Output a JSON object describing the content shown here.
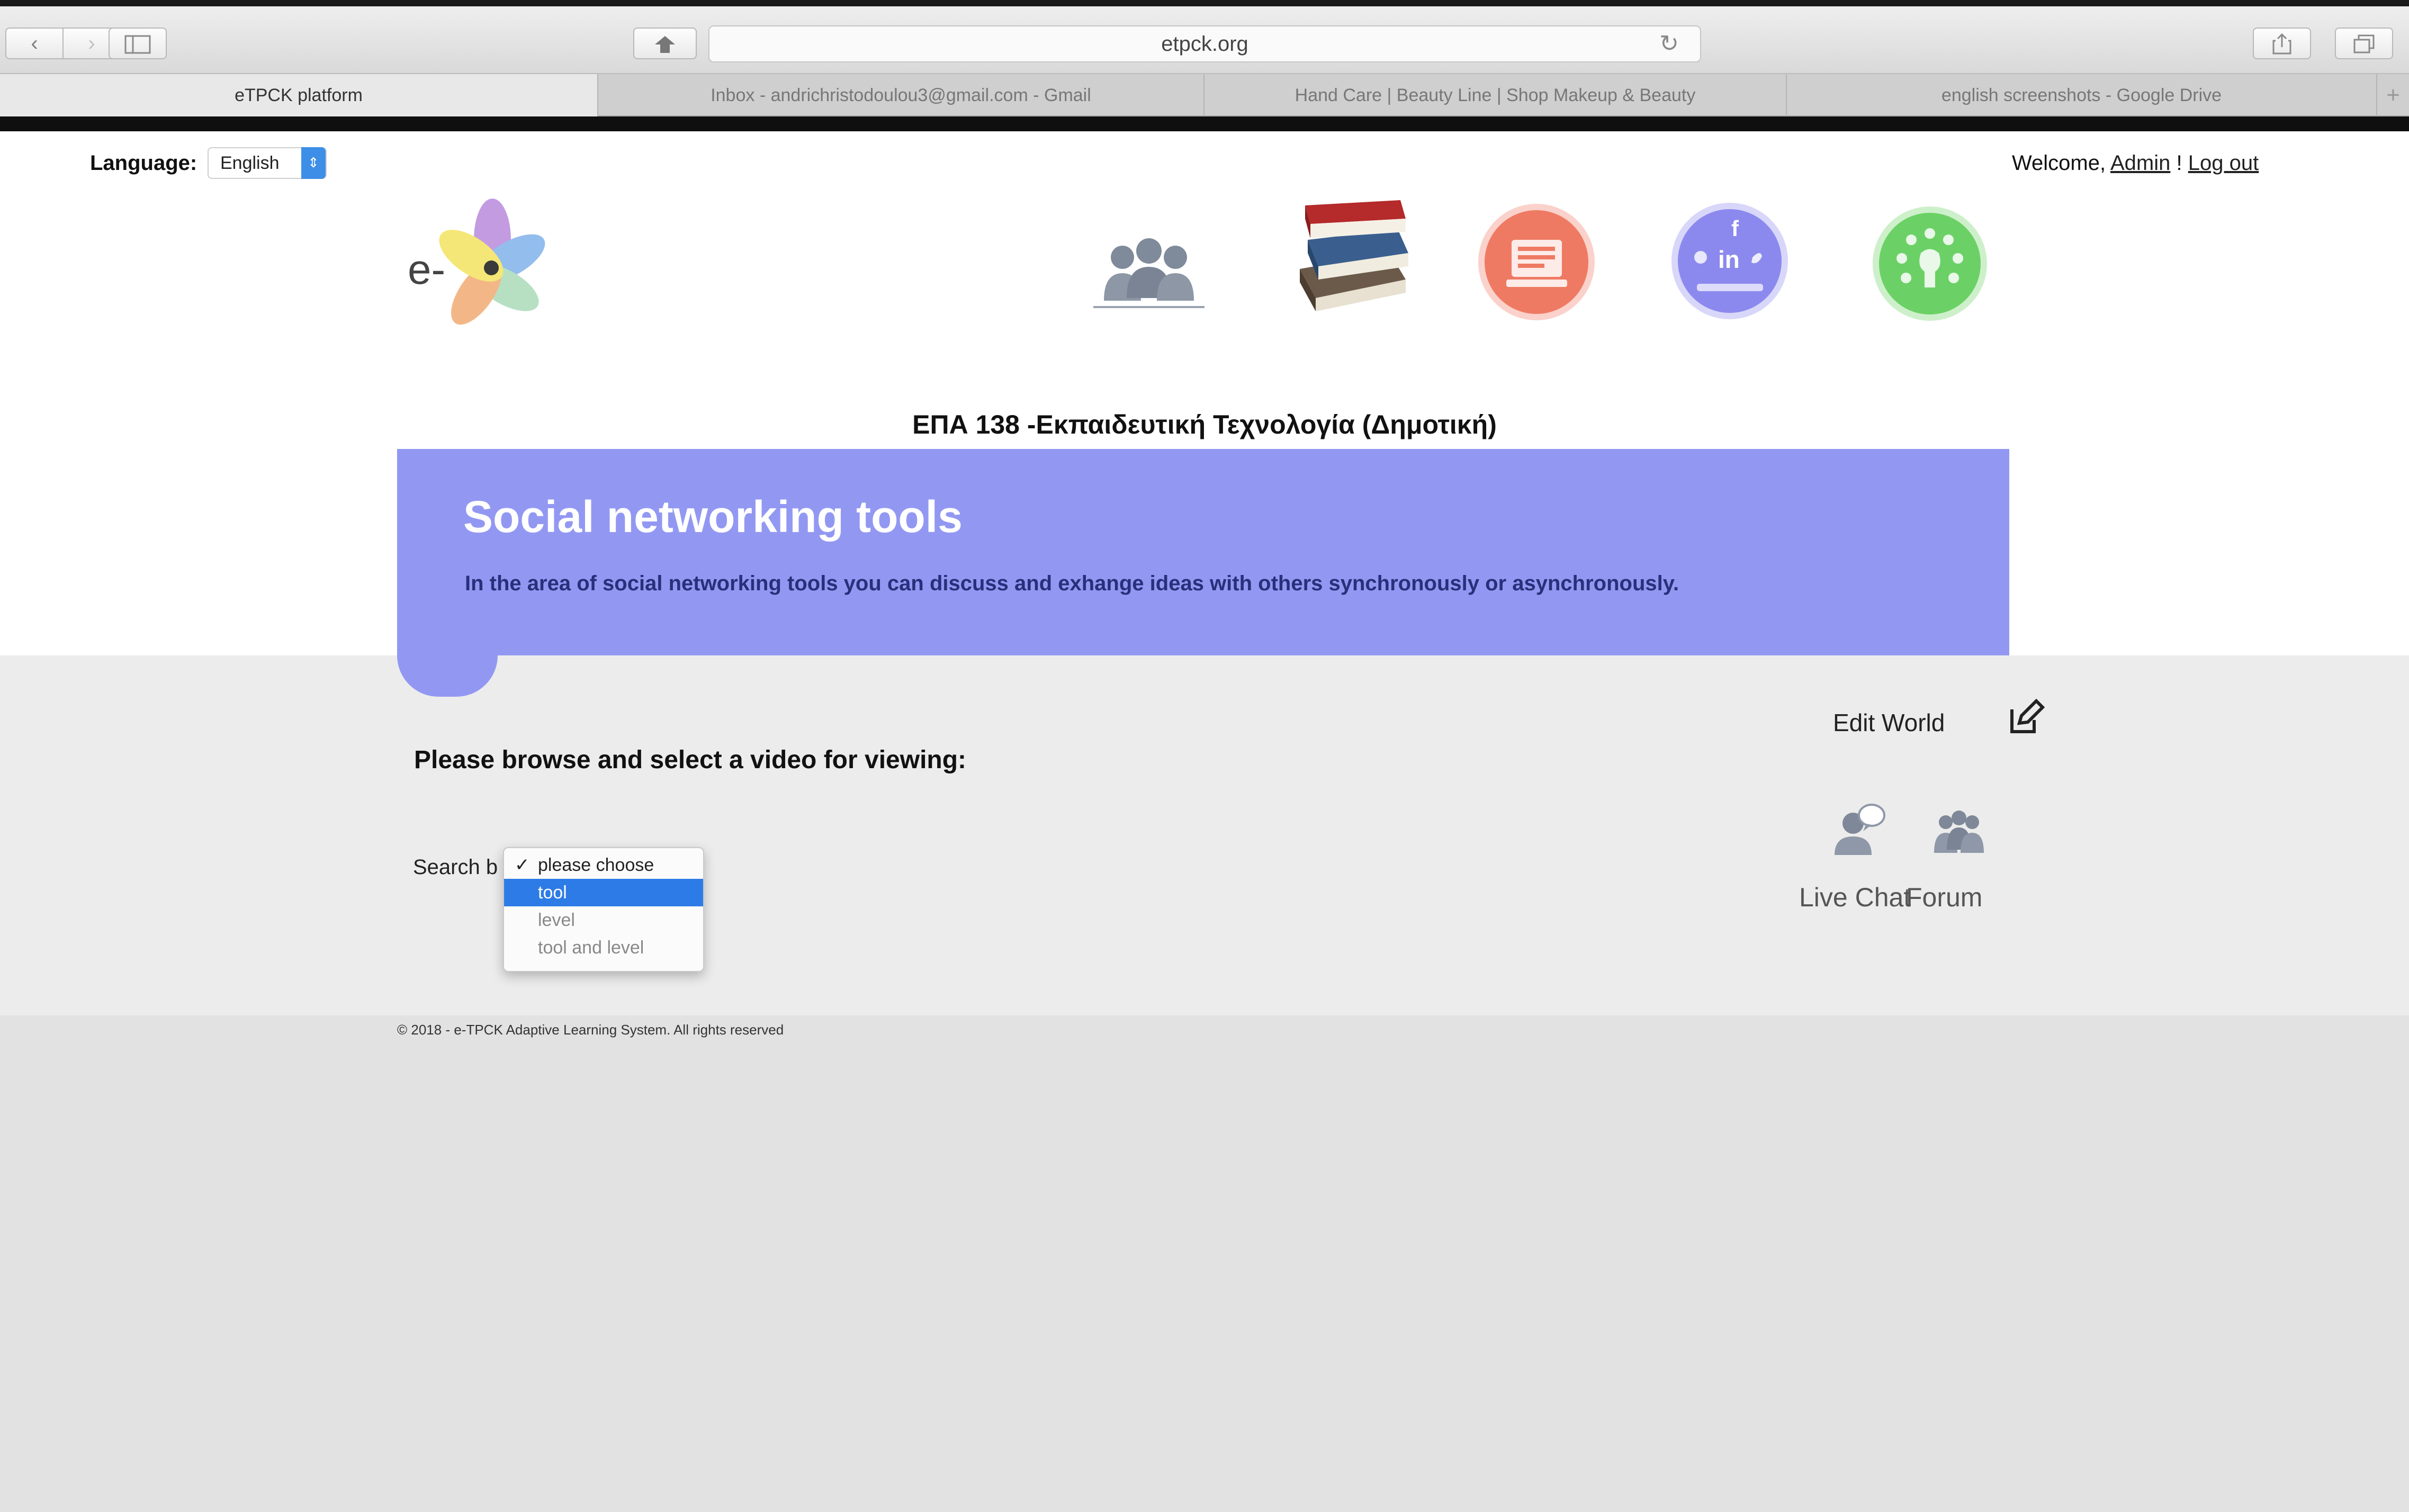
{
  "browser": {
    "url": "etpck.org",
    "tabs": [
      {
        "label": "eTPCK platform",
        "active": true
      },
      {
        "label": "Inbox - andrichristodoulou3@gmail.com - Gmail",
        "active": false
      },
      {
        "label": "Hand Care | Beauty Line | Shop Makeup & Beauty",
        "active": false
      },
      {
        "label": "english screenshots - Google Drive",
        "active": false
      }
    ],
    "icons": {
      "back": "chevron-left-icon",
      "forward": "chevron-right-icon",
      "sidebar": "sidebar-icon",
      "reload": "reload-icon",
      "share": "share-icon",
      "tabs": "tabs-icon",
      "new_tab": "plus-icon"
    }
  },
  "header": {
    "language_label": "Language:",
    "language_value": "English",
    "welcome_text": "Welcome,",
    "user_link": "Admin",
    "separator": "!",
    "logout_link": "Log out",
    "logo_text": "e-"
  },
  "nav_icons": [
    "people-icon",
    "books-icon",
    "course-icon",
    "social-media-icon",
    "idea-icon"
  ],
  "course_title": "ΕΠΑ 138 -Εκπαιδευτική Τεχνολογία (Δημοτική)",
  "banner": {
    "title": "Social networking tools",
    "description": "In the area of social networking tools you can discuss and exhange ideas with others synchronously or asynchronously.",
    "color": "#9298f2"
  },
  "content": {
    "browse_label": "Please browse and select a video for viewing:",
    "search_label": "Search b",
    "search_options": [
      {
        "label": "please choose",
        "selected": true,
        "highlighted": false
      },
      {
        "label": "tool",
        "selected": false,
        "highlighted": true
      },
      {
        "label": "level",
        "selected": false,
        "highlighted": false
      },
      {
        "label": "tool and level",
        "selected": false,
        "highlighted": false
      }
    ],
    "edit_world_label": "Edit World",
    "live_chat_label": "Live Chat",
    "forum_label": "Forum"
  },
  "footer": {
    "copyright": "© 2018 - e-TPCK Adaptive Learning System. All rights reserved"
  }
}
